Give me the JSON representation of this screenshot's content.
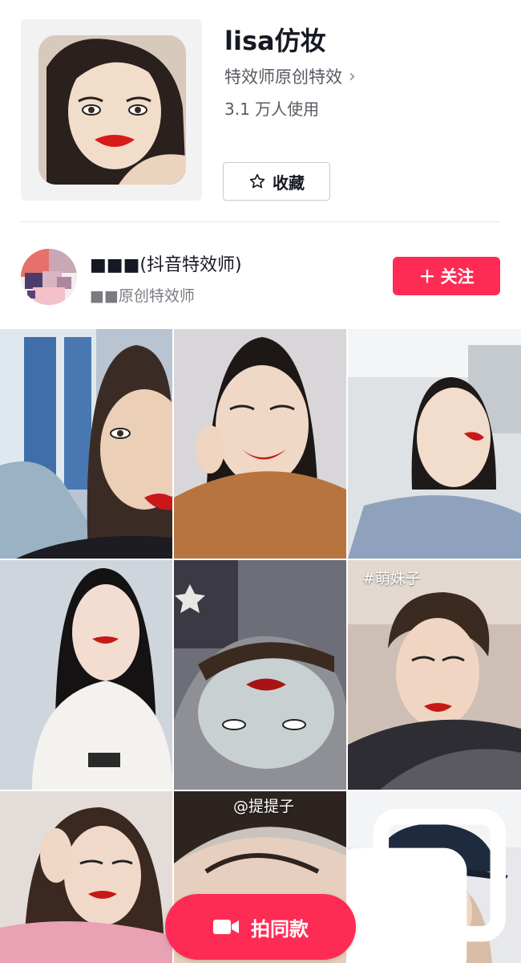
{
  "effect": {
    "title": "lisa仿妆",
    "creator_link": "特效师原创特效",
    "users": "3.1 万人使用",
    "favorite_label": "收藏"
  },
  "creator": {
    "name": "■■■(抖音特效师)",
    "subtitle": "■■原创特效师",
    "follow_label": "关注"
  },
  "grid": {
    "tiles": [
      {
        "tag": ""
      },
      {
        "tag": ""
      },
      {
        "tag": ""
      },
      {
        "tag": ""
      },
      {
        "tag": ""
      },
      {
        "tag": "#萌妹子"
      },
      {
        "tag": ""
      },
      {
        "tag": "@提提子"
      },
      {
        "tag": ""
      }
    ]
  },
  "actions": {
    "shoot_same_label": "拍同款"
  },
  "colors": {
    "accent": "#fe2c55",
    "text_primary": "#161823",
    "text_secondary": "#5a5b63"
  },
  "icons": {
    "star": "star-outline-icon",
    "chevron": "chevron-right-icon",
    "plus": "plus-icon",
    "camera": "video-camera-icon",
    "multi": "multi-image-icon"
  }
}
